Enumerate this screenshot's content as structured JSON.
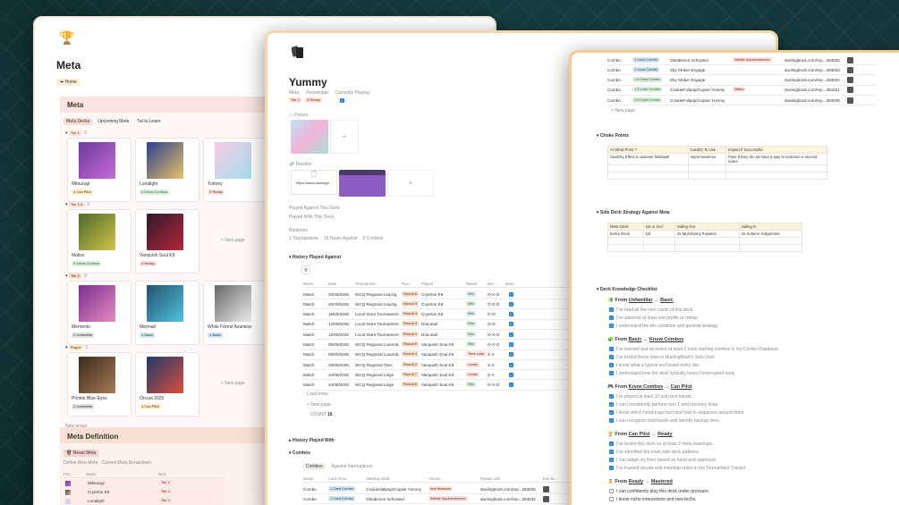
{
  "meta_page": {
    "title": "Meta",
    "home_label": "Home",
    "section_title": "Meta",
    "views": [
      "Meta Decks",
      "Upcoming Meta",
      "Tal to Learn"
    ],
    "groups": [
      {
        "label": "Tier 1",
        "count": "3",
        "cards": [
          {
            "name": "Mitsurugi",
            "tag": "4 Can Pilot"
          },
          {
            "name": "Lunalight",
            "tag": "0 Know Combos"
          },
          {
            "name": "Yummy",
            "tag": "0 Ready"
          }
        ]
      },
      {
        "label": "Tier 1.5",
        "count": "2",
        "cards": [
          {
            "name": "Maliss",
            "tag": "0 Know Combos"
          },
          {
            "name": "Vanquish Soul K9",
            "tag": "0 Ready"
          }
        ]
      },
      {
        "label": "Tier 2",
        "count": "3",
        "cards": [
          {
            "name": "Memento",
            "tag": "2 Unfamiliar"
          },
          {
            "name": "Mermail",
            "tag": "1 Basic"
          },
          {
            "name": "White Forest Azamina",
            "tag": "1 Basic"
          }
        ]
      },
      {
        "label": "Rogue",
        "count": "2",
        "cards": [
          {
            "name": "Primite Blue-Eyes",
            "tag": "2 Unfamiliar"
          },
          {
            "name": "Orcust 2025",
            "tag": "4 Can Pilot"
          }
        ]
      }
    ],
    "new_page": "New page",
    "new_group": "New group",
    "definition_title": "Meta Definition",
    "reset_button": "Reset Meta",
    "def_views": [
      "Define New Meta",
      "Current Meta Breakdown"
    ],
    "def_headers": [
      "Pict...",
      "Name",
      "Tiers"
    ],
    "def_rows": [
      {
        "name": "Mitsurugi",
        "tier": "Tier 1"
      },
      {
        "name": "Crystron K9",
        "tier": "Tier 1"
      },
      {
        "name": "Lunalight",
        "tier": "Tier 1"
      }
    ]
  },
  "yummy": {
    "title": "Yummy",
    "prop_labels": [
      "Meta",
      "Knowledge",
      "Currently Playing"
    ],
    "prop_values": [
      "Tier 1",
      "5 Ready"
    ],
    "picture_label": "Picture",
    "decklist_label": "Decklist",
    "decklist_url": "https://www.duelingb...",
    "links": [
      "Played Against This Deck",
      "Played With This Deck"
    ],
    "relations_label": "Relations",
    "relations": [
      "1 Tournaments",
      "16 Duels Against",
      "6 Combos"
    ],
    "history_title": "History Played Against",
    "history_headers": [
      "Name",
      "Date",
      "Tournament",
      "Rou...",
      "Played",
      "Result",
      "Del...",
      "Dow..."
    ],
    "history_rows": [
      {
        "name": "Match",
        "date": "20/09/2025",
        "tour": "WCQ Regional Leipzig",
        "round": "Round 8",
        "played": "Crystron K9",
        "result": "Win",
        "score": "O-X-O"
      },
      {
        "name": "Match",
        "date": "20/09/2025",
        "tour": "WCQ Regional Leipzig",
        "round": "Round 3",
        "played": "Crystron K9",
        "result": "Win",
        "score": "O-X-O"
      },
      {
        "name": "Match",
        "date": "18/09/2025",
        "tour": "Local Store Tournament",
        "round": "Round 4",
        "played": "Crystron K9",
        "result": "Win",
        "score": "O-O"
      },
      {
        "name": "Match",
        "date": "12/09/2025",
        "tour": "Local Store Tournament",
        "round": "Round 4",
        "played": "Dracotail",
        "result": "Win",
        "score": "O-O"
      },
      {
        "name": "Match",
        "date": "12/09/2025",
        "tour": "Local Store Tournament",
        "round": "Round 1",
        "played": "Dracotail",
        "result": "Win",
        "score": "O-X-O"
      },
      {
        "name": "Match",
        "date": "06/09/2025",
        "tour": "WCQ Regional Luxemb.",
        "round": "Round 5",
        "played": "Vanquish Soul K9",
        "result": "Win",
        "score": "O-X-O"
      },
      {
        "name": "Match",
        "date": "06/09/2025",
        "tour": "WCQ Regional Luxemb.",
        "round": "Round 4",
        "played": "Vanquish Soul K9",
        "result": "Time Loss",
        "score": "X-X"
      },
      {
        "name": "Match",
        "date": "30/08/2025",
        "tour": "WCQ Regional Trier",
        "round": "Round 2",
        "played": "Vanquish Soul K9",
        "result": "Loose",
        "score": "X-X"
      },
      {
        "name": "Match",
        "date": "24/08/2025",
        "tour": "WCQ Regional Liège",
        "round": "Round 7",
        "played": "Vanquish Soul K9",
        "result": "Loose",
        "score": "X-X"
      },
      {
        "name": "Match",
        "date": "24/08/2025",
        "tour": "WCQ Regional Liège",
        "round": "Round 6",
        "played": "Vanquish Soul K9",
        "result": "Win",
        "score": "O-X-O"
      }
    ],
    "load_more": "Load more",
    "new_page": "New page",
    "count_label": "COUNT",
    "count_value": "16",
    "history_with": "History Played With",
    "combos_title": "Combos",
    "combo_tabs": [
      "Combos",
      "Against Interruptions"
    ],
    "combo_headers": [
      "Name",
      "Card Amo...",
      "Starting Hand",
      "Versus",
      "Replay Link",
      "End B..."
    ],
    "combo_rows": [
      {
        "name": "Combo",
        "cards": "1 Card Combo",
        "hand": "Cookieslalipop/Cupsie Yummy",
        "versus": "Ash Blossom",
        "link": "duelingbook.com/rep...283830"
      },
      {
        "name": "Combo",
        "cards": "1 Card Combo",
        "hand": "Obedience Schooled",
        "versus": "Infinite Impermanence",
        "link": "duelingbook.com/rep...283832"
      }
    ]
  },
  "strategy": {
    "combo_rows": [
      {
        "name": "Combo",
        "cards": "1 Card Combo",
        "hand": "Obedience Schooled",
        "versus": "Infinite Impermanence",
        "link": "duelingbook.com/rep...283832"
      },
      {
        "name": "Combo",
        "cards": "1 Card Combo",
        "hand": "Sky Striker Engage",
        "versus": "",
        "link": "duelingbook.com/rep...283833"
      },
      {
        "name": "Combo",
        "cards": "1.5 Card Combo",
        "hand": "Sky Striker Engage",
        "versus": "",
        "link": "duelingbook.com/rep...283834"
      },
      {
        "name": "Combo",
        "cards": "1.5 Card Combo",
        "hand": "CookieFullpop/Cupsie Yummy",
        "versus": "Nibiru",
        "link": "duelingbook.com/rep...281021"
      },
      {
        "name": "Combo",
        "cards": "1.5 Card Combo",
        "hand": "CookieFullpop/Cupsie Yummy",
        "versus": "",
        "link": "duelingbook.com/rep...283035"
      }
    ],
    "new_page": "New page",
    "choke_title": "Choke Points",
    "choke_headers": [
      "At What Point ?",
      "Card(s) To Use",
      "Impact If Successful"
    ],
    "choke_rows": [
      [
        "Snatchy Effect to activate fieldspell",
        "Impermanence",
        "Pass if they do not have a way to summon a second name"
      ]
    ],
    "side_title": "Side Deck Strategy Against Meta",
    "side_headers": [
      "Meta Deck",
      "1st or 2nd",
      "Siding Out",
      "Siding In"
    ],
    "side_rows": [
      [
        "Every Deck",
        "1st",
        "3x Mulcharmy Fuwalos",
        "3x Solemn Judgement"
      ]
    ],
    "checklist_title": "Deck Knowledge Checklist",
    "checklist": [
      {
        "from": "Unfamiliar",
        "to": "Basic",
        "items": [
          {
            "t": "I've read all the core cards of this deck.",
            "c": true
          },
          {
            "t": "I've watched at least one profile or replay.",
            "c": true
          },
          {
            "t": "I understand the win condition and general strategy.",
            "c": true
          }
        ]
      },
      {
        "from": "Basic",
        "to": "Know Combos",
        "items": [
          {
            "t": "I've learned and recorded at least 2 main starting combos in my Combo Database.",
            "c": true
          },
          {
            "t": "I've tested these lines in DuelingBook's Solo Duel.",
            "c": true
          },
          {
            "t": "I know what a typical end board looks like.",
            "c": true
          },
          {
            "t": "I understand how the deck typically loses if interrupted early.",
            "c": true
          }
        ]
      },
      {
        "from": "Know Combos",
        "to": "Can Pilot",
        "items": [
          {
            "t": "I've played at least 10 solo test hands.",
            "c": true
          },
          {
            "t": "I can consistently perform turn 1 and recovery lines.",
            "c": true
          },
          {
            "t": "I know which hand-traps hurt and how to sequence around them.",
            "c": true
          },
          {
            "t": "I can recognize bad hands and identify backup lines.",
            "c": true
          }
        ]
      },
      {
        "from": "Can Pilot",
        "to": "Ready",
        "items": [
          {
            "t": "I've tested this deck vs at least 2 meta matchups.",
            "c": true
          },
          {
            "t": "I've identified the main side-deck patterns.",
            "c": true
          },
          {
            "t": "I can adapt my lines based on hand and opponent.",
            "c": true
          },
          {
            "t": "I've tracked results and matchup notes in my Tournament Tracker.",
            "c": true
          }
        ]
      },
      {
        "from": "Ready",
        "to": "Mastered",
        "items": [
          {
            "t": "I can confidently play this deck under pressure.",
            "c": false
          },
          {
            "t": "I know niche interactions and rare techs.",
            "c": false
          }
        ]
      }
    ]
  },
  "colors": {
    "win": "#dbeddb",
    "loss": "#ffe2dd",
    "round": "#fadec9",
    "accent": "#2383e2"
  }
}
